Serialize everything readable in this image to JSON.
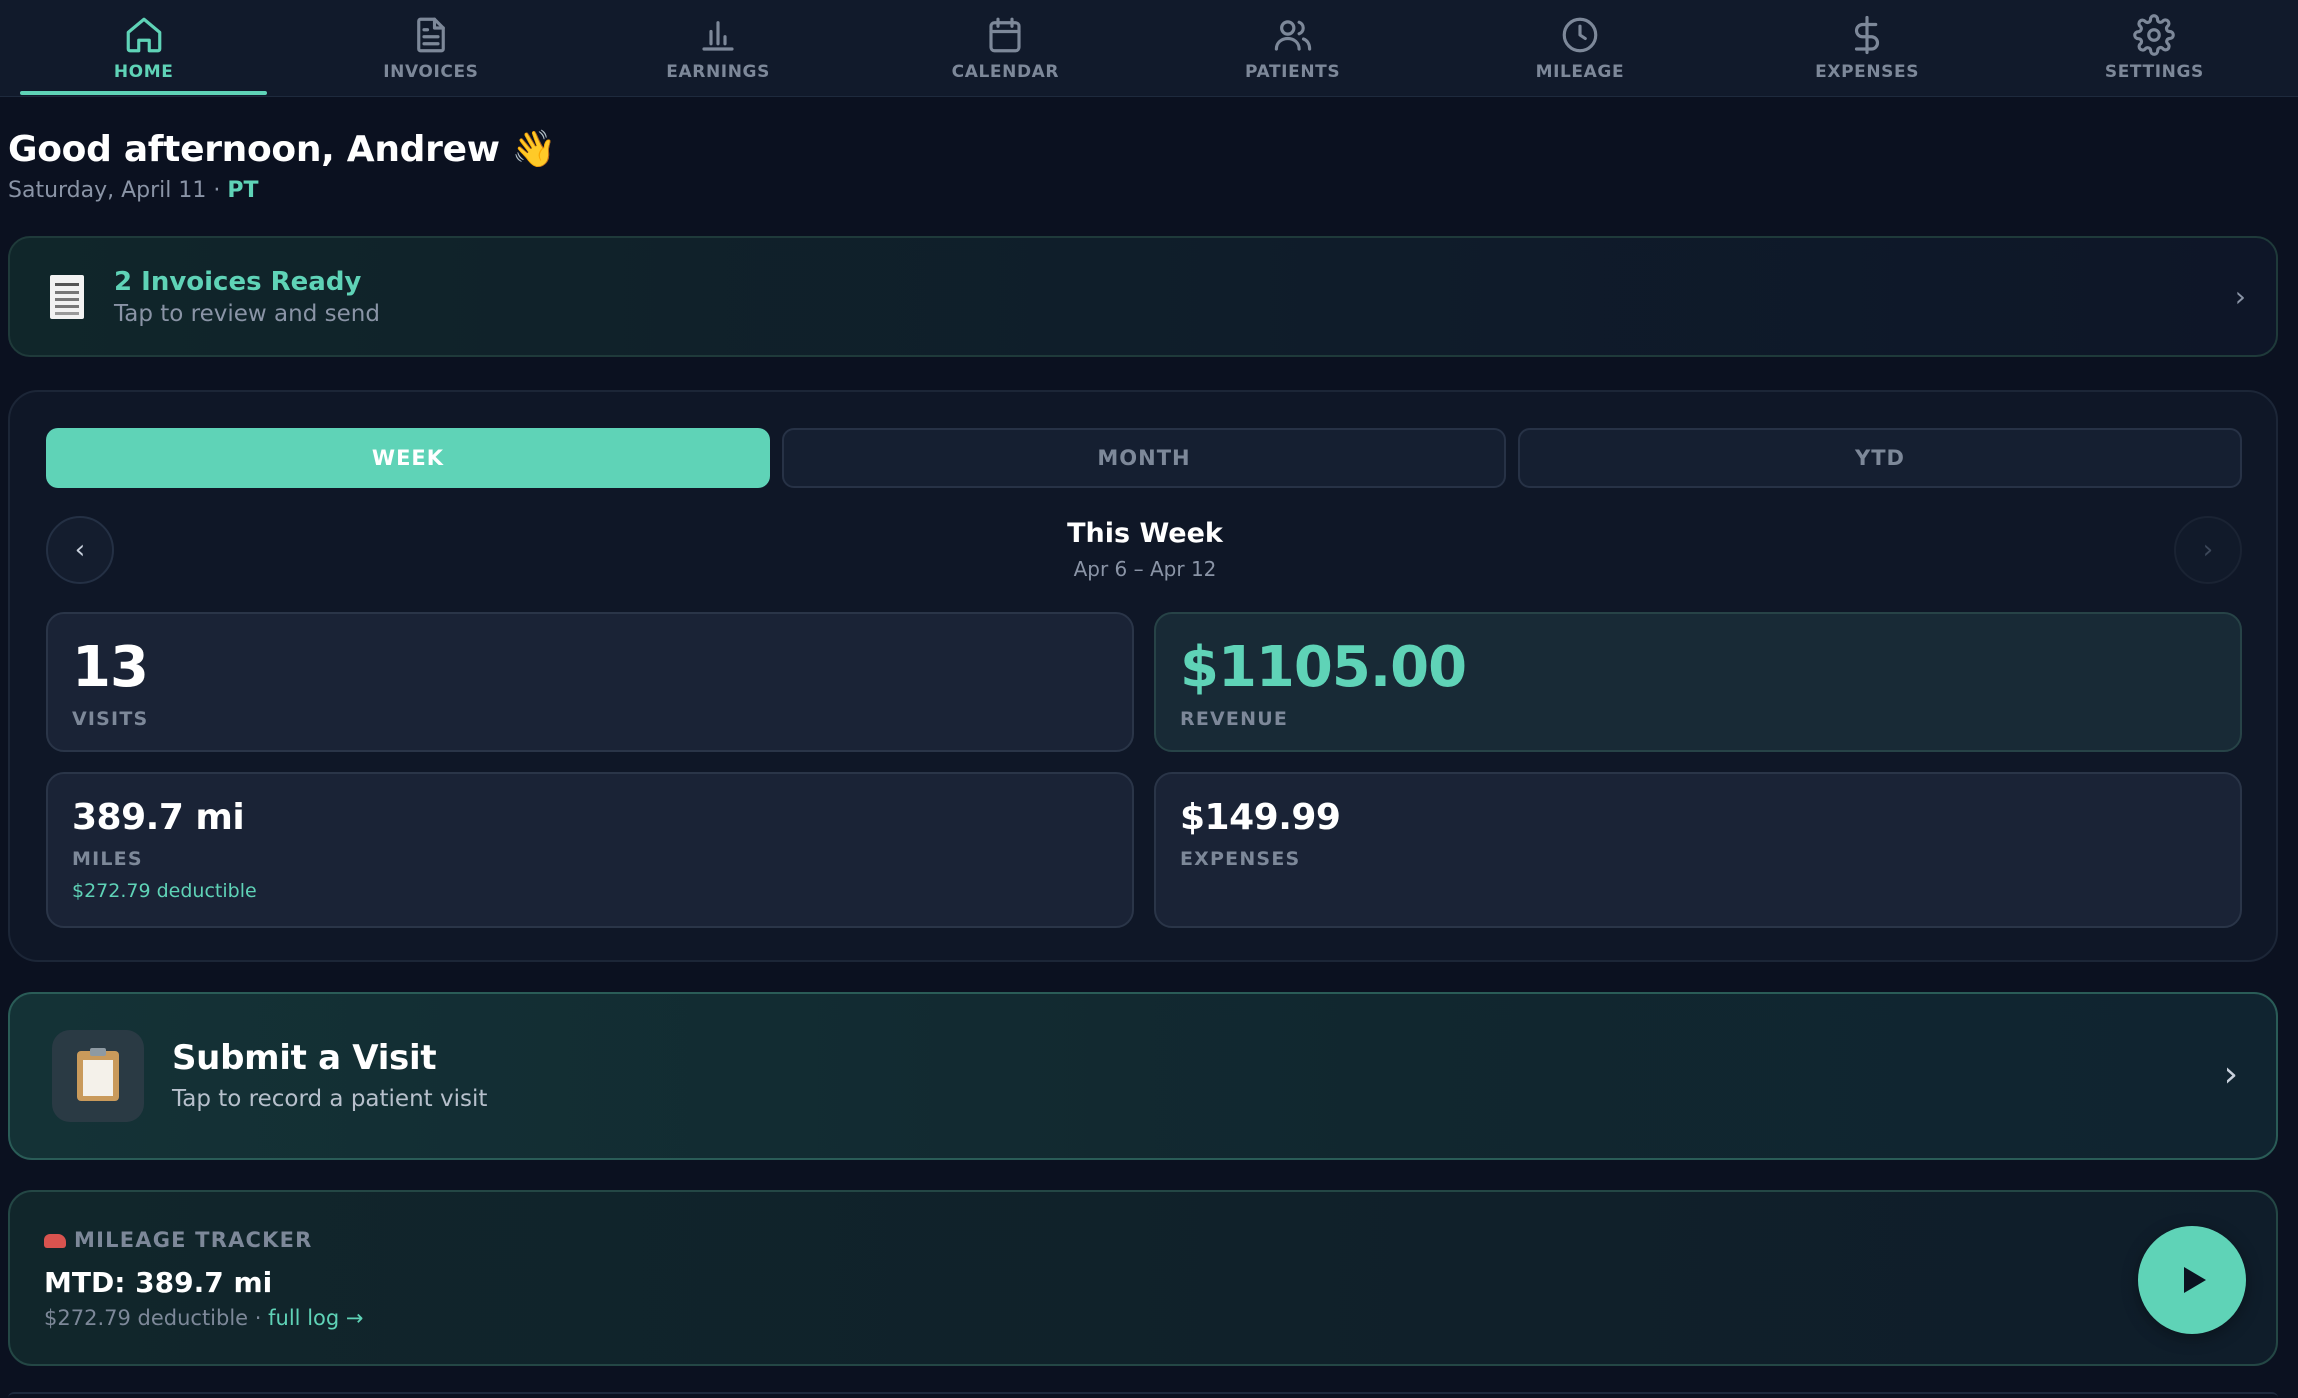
{
  "nav": {
    "items": [
      {
        "label": "HOME",
        "icon": "home-icon",
        "active": true
      },
      {
        "label": "INVOICES",
        "icon": "document-icon",
        "active": false
      },
      {
        "label": "EARNINGS",
        "icon": "bar-chart-icon",
        "active": false
      },
      {
        "label": "CALENDAR",
        "icon": "calendar-icon",
        "active": false
      },
      {
        "label": "PATIENTS",
        "icon": "users-icon",
        "active": false
      },
      {
        "label": "MILEAGE",
        "icon": "clock-icon",
        "active": false
      },
      {
        "label": "EXPENSES",
        "icon": "dollar-icon",
        "active": false
      },
      {
        "label": "SETTINGS",
        "icon": "gear-icon",
        "active": false
      }
    ]
  },
  "greeting": {
    "title": "Good afternoon, Andrew 👋",
    "date": "Saturday, April 11 · ",
    "timezone": "PT"
  },
  "invoice_banner": {
    "icon": "receipt-icon",
    "title": "2 Invoices Ready",
    "subtitle": "Tap to review and send",
    "chevron": "›"
  },
  "stats": {
    "segments": [
      "WEEK",
      "MONTH",
      "YTD"
    ],
    "selected_segment": "WEEK",
    "prev_label": "‹",
    "next_label": "›",
    "period_title": "This Week",
    "period_range": "Apr 6 – Apr 12",
    "visits": {
      "value": "13",
      "label": "VISITS"
    },
    "revenue": {
      "value": "$1105.00",
      "label": "REVENUE"
    },
    "miles": {
      "value": "389.7 mi",
      "label": "MILES",
      "note": "$272.79 deductible"
    },
    "expenses": {
      "value": "$149.99",
      "label": "EXPENSES"
    }
  },
  "submit_visit": {
    "icon": "clipboard-icon",
    "title": "Submit a Visit",
    "subtitle": "Tap to record a patient visit",
    "chevron": "›"
  },
  "mileage_tracker": {
    "icon": "car-icon",
    "heading": "MILEAGE TRACKER",
    "main": "MTD: 389.7 mi",
    "sub": "$272.79 deductible · ",
    "link": "full log →",
    "play_icon": "play-icon"
  },
  "colors": {
    "accent": "#5fd3b7",
    "background": "#0b1120",
    "muted": "#7d8899"
  }
}
